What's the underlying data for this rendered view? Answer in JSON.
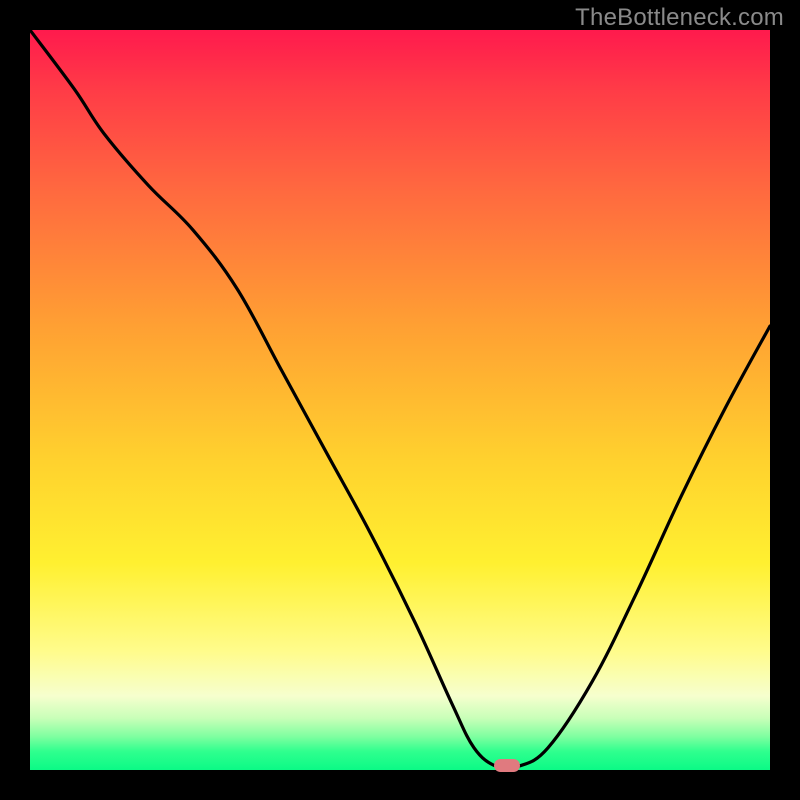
{
  "watermark": "TheBottleneck.com",
  "chart_data": {
    "type": "line",
    "title": "",
    "xlabel": "",
    "ylabel": "",
    "xlim": [
      0,
      100
    ],
    "ylim": [
      0,
      100
    ],
    "x": [
      0,
      6,
      10,
      16,
      22,
      28,
      34,
      40,
      46,
      52,
      57,
      60,
      63,
      66,
      70,
      76,
      82,
      88,
      94,
      100
    ],
    "y": [
      100,
      92,
      86,
      79,
      73,
      65,
      54,
      43,
      32,
      20,
      9,
      3,
      0.5,
      0.5,
      3,
      12,
      24,
      37,
      49,
      60
    ],
    "marker": {
      "x": 64.5,
      "y": 0.5
    },
    "background_gradient": {
      "direction": "top-to-bottom",
      "stops": [
        {
          "pos": 0,
          "color": "#ff1a4d"
        },
        {
          "pos": 0.22,
          "color": "#ff6a3f"
        },
        {
          "pos": 0.58,
          "color": "#ffd12e"
        },
        {
          "pos": 0.84,
          "color": "#fffc8c"
        },
        {
          "pos": 0.97,
          "color": "#2fff8e"
        },
        {
          "pos": 1.0,
          "color": "#0bfa86"
        }
      ]
    }
  }
}
